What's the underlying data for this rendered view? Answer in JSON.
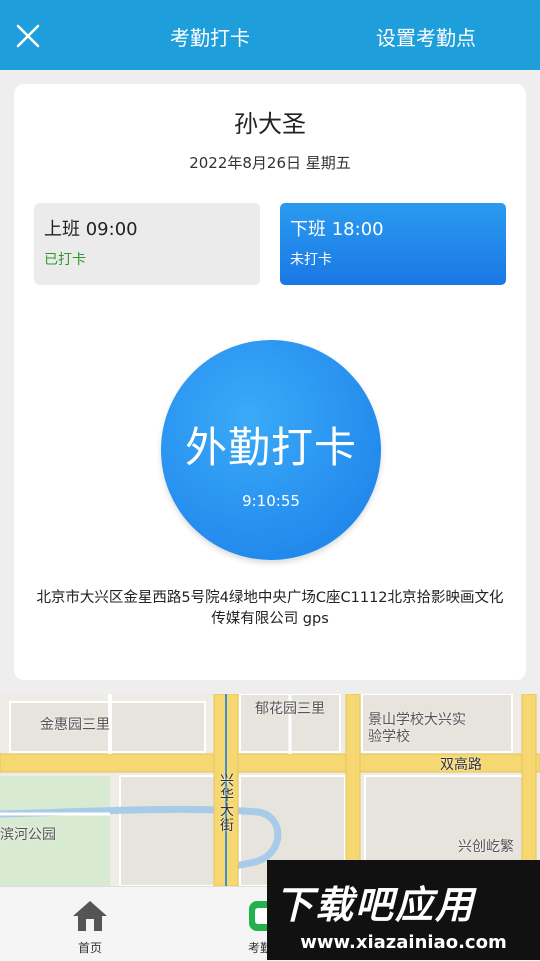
{
  "header": {
    "title": "考勤打卡",
    "set_point_label": "设置考勤点",
    "close_icon": "close-icon"
  },
  "card": {
    "name": "孙大圣",
    "date": "2022年8月26日 星期五",
    "shifts": [
      {
        "title": "上班 09:00",
        "status": "已打卡",
        "status_color": "#2d9a2d"
      },
      {
        "title": "下班 18:00",
        "status": "未打卡"
      }
    ],
    "punch_button": {
      "label": "外勤打卡",
      "time": "9:10:55"
    },
    "address": "北京市大兴区金星西路5号院4绿地中央广场C座C1112北京拾影映画文化传媒有限公司 gps"
  },
  "map": {
    "labels": [
      "金惠园三里",
      "郁花园三里",
      "景山学校大兴实验学校",
      "双高路",
      "兴华大街",
      "滨河公园",
      "兴创屹繁"
    ]
  },
  "tabbar": {
    "items": [
      {
        "label": "首页",
        "icon": "home-icon"
      },
      {
        "label": "考勤",
        "icon": "attendance-icon"
      }
    ]
  },
  "watermark": {
    "title": "下载吧应用",
    "url": "www.xiazainiao.com"
  },
  "colors": {
    "header_bg": "#1e9fdc",
    "punch_blue": "#1a7ee8",
    "checked_green": "#2d9a2d"
  }
}
